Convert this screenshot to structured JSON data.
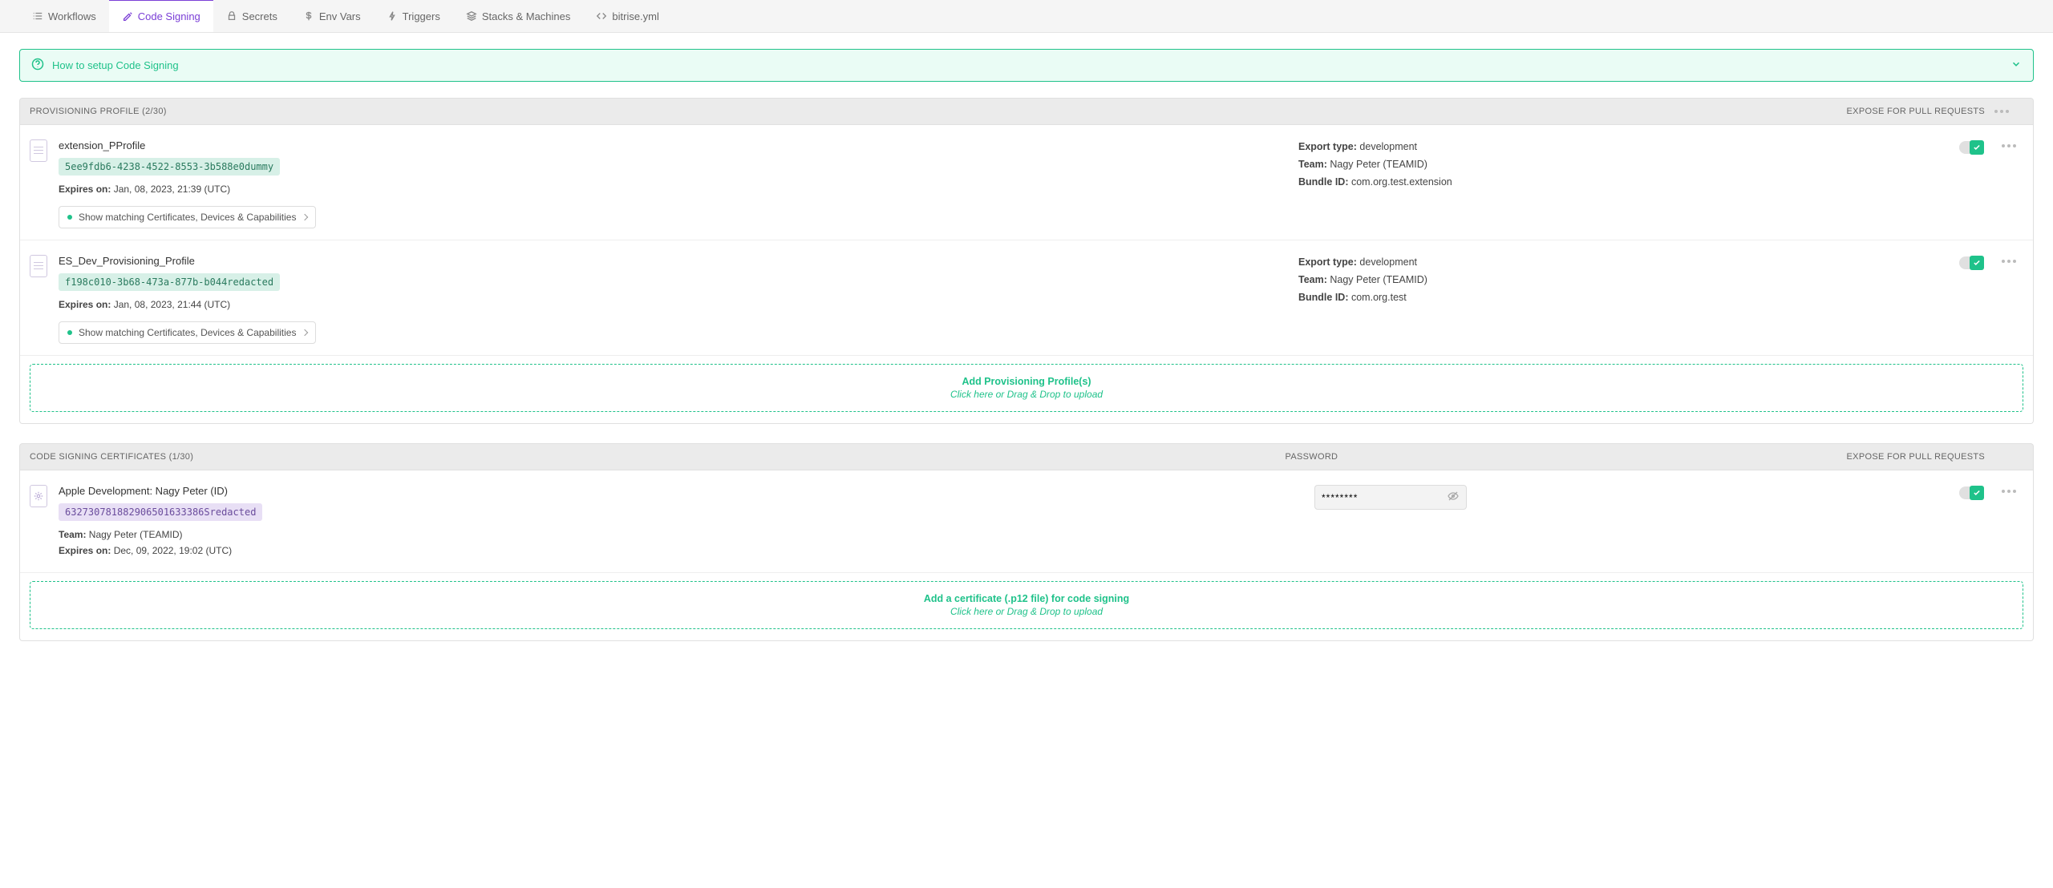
{
  "tabs": [
    {
      "label": "Workflows"
    },
    {
      "label": "Code Signing"
    },
    {
      "label": "Secrets"
    },
    {
      "label": "Env Vars"
    },
    {
      "label": "Triggers"
    },
    {
      "label": "Stacks & Machines"
    },
    {
      "label": "bitrise.yml"
    }
  ],
  "banner": {
    "title": "How to setup Code Signing"
  },
  "provisioning": {
    "header": "PROVISIONING PROFILE (2/30)",
    "exposeHeader": "EXPOSE FOR PULL REQUESTS",
    "matchBtn": "Show matching Certificates, Devices & Capabilities",
    "labels": {
      "expires": "Expires on:",
      "exportType": "Export type:",
      "team": "Team:",
      "bundle": "Bundle ID:"
    },
    "items": [
      {
        "name": "extension_PProfile",
        "uuid": "5ee9fdb6-4238-4522-8553-3b588e0dummy",
        "expires": "Jan, 08, 2023, 21:39 (UTC)",
        "exportType": "development",
        "team": "Nagy Peter (TEAMID)",
        "bundle": "com.org.test.extension"
      },
      {
        "name": "ES_Dev_Provisioning_Profile",
        "uuid": "f198c010-3b68-473a-877b-b044redacted",
        "expires": "Jan, 08, 2023, 21:44 (UTC)",
        "exportType": "development",
        "team": "Nagy Peter (TEAMID)",
        "bundle": "com.org.test"
      }
    ],
    "dropzone": {
      "title": "Add Provisioning Profile(s)",
      "sub": "Click here or Drag & Drop to upload"
    }
  },
  "certs": {
    "header": "CODE SIGNING CERTIFICATES (1/30)",
    "passwordHeader": "PASSWORD",
    "exposeHeader": "EXPOSE FOR PULL REQUESTS",
    "labels": {
      "team": "Team:",
      "expires": "Expires on:"
    },
    "passwordValue": "********",
    "items": [
      {
        "name": "Apple Development: Nagy Peter (ID)",
        "serial": "632730781882906501633386Sredacted",
        "team": "Nagy Peter (TEAMID)",
        "expires": "Dec, 09, 2022, 19:02 (UTC)"
      }
    ],
    "dropzone": {
      "title": "Add a certificate (.p12 file) for code signing",
      "sub": "Click here or Drag & Drop to upload"
    }
  }
}
